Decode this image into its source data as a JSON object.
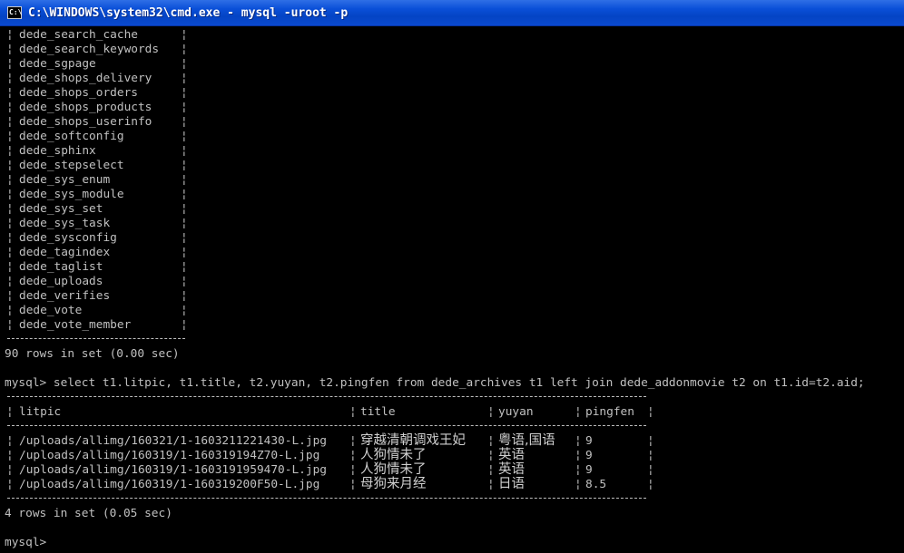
{
  "window": {
    "title": "C:\\WINDOWS\\system32\\cmd.exe - mysql -uroot -p",
    "icon": "cmd-icon",
    "icon_glyph": "C:\\"
  },
  "tables_list": [
    "dede_search_cache",
    "dede_search_keywords",
    "dede_sgpage",
    "dede_shops_delivery",
    "dede_shops_orders",
    "dede_shops_products",
    "dede_shops_userinfo",
    "dede_softconfig",
    "dede_sphinx",
    "dede_stepselect",
    "dede_sys_enum",
    "dede_sys_module",
    "dede_sys_set",
    "dede_sys_task",
    "dede_sysconfig",
    "dede_tagindex",
    "dede_taglist",
    "dede_uploads",
    "dede_verifies",
    "dede_vote",
    "dede_vote_member"
  ],
  "tables_summary": "90 rows in set (0.00 sec)",
  "query_line": "mysql> select t1.litpic, t1.title, t2.yuyan, t2.pingfen from dede_archives t1 left join dede_addonmovie t2 on t1.id=t2.aid;",
  "result": {
    "headers": [
      "litpic",
      "title",
      "yuyan",
      "pingfen"
    ],
    "rows": [
      [
        "/uploads/allimg/160321/1-1603211221430-L.jpg",
        "穿越清朝调戏王妃",
        "粤语,国语",
        "9"
      ],
      [
        "/uploads/allimg/160319/1-160319194Z70-L.jpg",
        "人狗情未了",
        "英语",
        "9"
      ],
      [
        "/uploads/allimg/160319/1-1603191959470-L.jpg",
        "人狗情未了",
        "英语",
        "9"
      ],
      [
        "/uploads/allimg/160319/1-160319200F50-L.jpg",
        "母狗来月经",
        "日语",
        "8.5"
      ]
    ],
    "summary": "4 rows in set (0.05 sec)"
  },
  "prompt": "mysql>"
}
